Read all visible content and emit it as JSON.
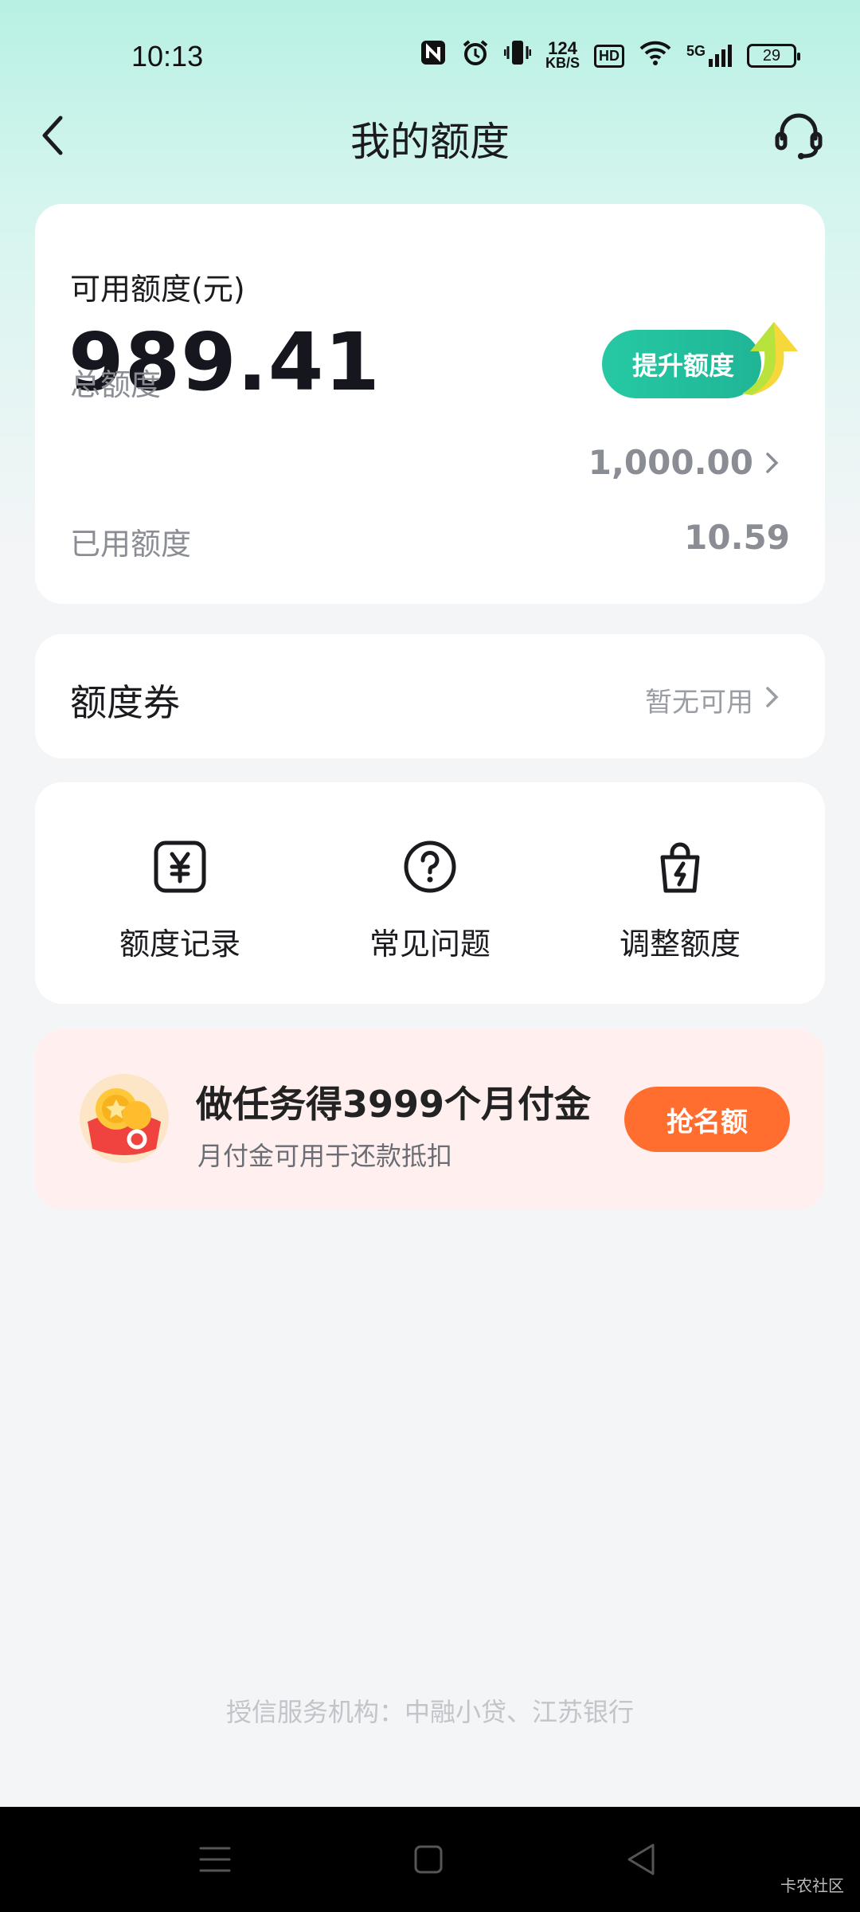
{
  "status_bar": {
    "time": "10:13",
    "speed_value": "124",
    "speed_unit": "KB/S",
    "hd": "HD",
    "network": "5G",
    "battery": "29"
  },
  "header": {
    "title": "我的额度"
  },
  "quota": {
    "available_label": "可用额度(元)",
    "available_value": "989.41",
    "raise_label": "提升额度",
    "total_label": "总额度",
    "total_value": "1,000.00",
    "used_label": "已用额度",
    "used_value": "10.59"
  },
  "coupon": {
    "title": "额度券",
    "status": "暂无可用"
  },
  "actions": [
    {
      "label": "额度记录",
      "icon": "yen-record-icon"
    },
    {
      "label": "常见问题",
      "icon": "question-icon"
    },
    {
      "label": "调整额度",
      "icon": "bag-bolt-icon"
    }
  ],
  "promo": {
    "title": "做任务得3999个月付金",
    "subtitle": "月付金可用于还款抵扣",
    "button": "抢名额"
  },
  "footer": {
    "text": "授信服务机构：中融小贷、江苏银行"
  },
  "watermark": "卡农社区",
  "colors": {
    "accent_green": "#26c9a4",
    "promo_orange": "#ff6e2e",
    "header_bg": "#b8f0e4"
  }
}
